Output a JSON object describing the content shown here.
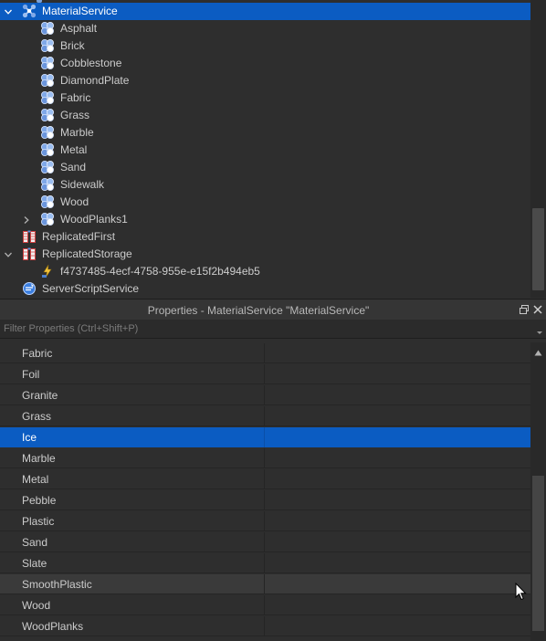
{
  "explorer": {
    "items": [
      {
        "label": "MaterialService",
        "icon": "material-service-icon",
        "indent": 0,
        "expander": "expanded",
        "selected": true
      },
      {
        "label": "Asphalt",
        "icon": "material-variant-icon",
        "indent": 1,
        "expander": "none"
      },
      {
        "label": "Brick",
        "icon": "material-variant-icon",
        "indent": 1,
        "expander": "none"
      },
      {
        "label": "Cobblestone",
        "icon": "material-variant-icon",
        "indent": 1,
        "expander": "none"
      },
      {
        "label": "DiamondPlate",
        "icon": "material-variant-icon",
        "indent": 1,
        "expander": "none"
      },
      {
        "label": "Fabric",
        "icon": "material-variant-icon",
        "indent": 1,
        "expander": "none"
      },
      {
        "label": "Grass",
        "icon": "material-variant-icon",
        "indent": 1,
        "expander": "none"
      },
      {
        "label": "Marble",
        "icon": "material-variant-icon",
        "indent": 1,
        "expander": "none"
      },
      {
        "label": "Metal",
        "icon": "material-variant-icon",
        "indent": 1,
        "expander": "none"
      },
      {
        "label": "Sand",
        "icon": "material-variant-icon",
        "indent": 1,
        "expander": "none"
      },
      {
        "label": "Sidewalk",
        "icon": "material-variant-icon",
        "indent": 1,
        "expander": "none"
      },
      {
        "label": "Wood",
        "icon": "material-variant-icon",
        "indent": 1,
        "expander": "none"
      },
      {
        "label": "WoodPlanks1",
        "icon": "material-variant-icon",
        "indent": 1,
        "expander": "collapsed"
      },
      {
        "label": "ReplicatedFirst",
        "icon": "replicated-first-icon",
        "indent": 0,
        "expander": "none"
      },
      {
        "label": "ReplicatedStorage",
        "icon": "replicated-storage-icon",
        "indent": 0,
        "expander": "expanded"
      },
      {
        "label": "f4737485-4ecf-4758-955e-e15f2b494eb5",
        "icon": "bindable-event-icon",
        "indent": 1,
        "expander": "none"
      },
      {
        "label": "ServerScriptService",
        "icon": "server-script-service-icon",
        "indent": 0,
        "expander": "none"
      }
    ]
  },
  "properties": {
    "title": "Properties - MaterialService \"MaterialService\"",
    "filter_placeholder": "Filter Properties (Ctrl+Shift+P)",
    "rows": [
      {
        "name": "Fabric"
      },
      {
        "name": "Foil"
      },
      {
        "name": "Granite"
      },
      {
        "name": "Grass"
      },
      {
        "name": "Ice",
        "selected": true
      },
      {
        "name": "Marble"
      },
      {
        "name": "Metal"
      },
      {
        "name": "Pebble"
      },
      {
        "name": "Plastic"
      },
      {
        "name": "Sand"
      },
      {
        "name": "Slate"
      },
      {
        "name": "SmoothPlastic",
        "hovered": true
      },
      {
        "name": "Wood"
      },
      {
        "name": "WoodPlanks"
      }
    ]
  },
  "colors": {
    "selection": "#0b5cc2",
    "background": "#2e2e2e",
    "text": "#cccccc"
  }
}
